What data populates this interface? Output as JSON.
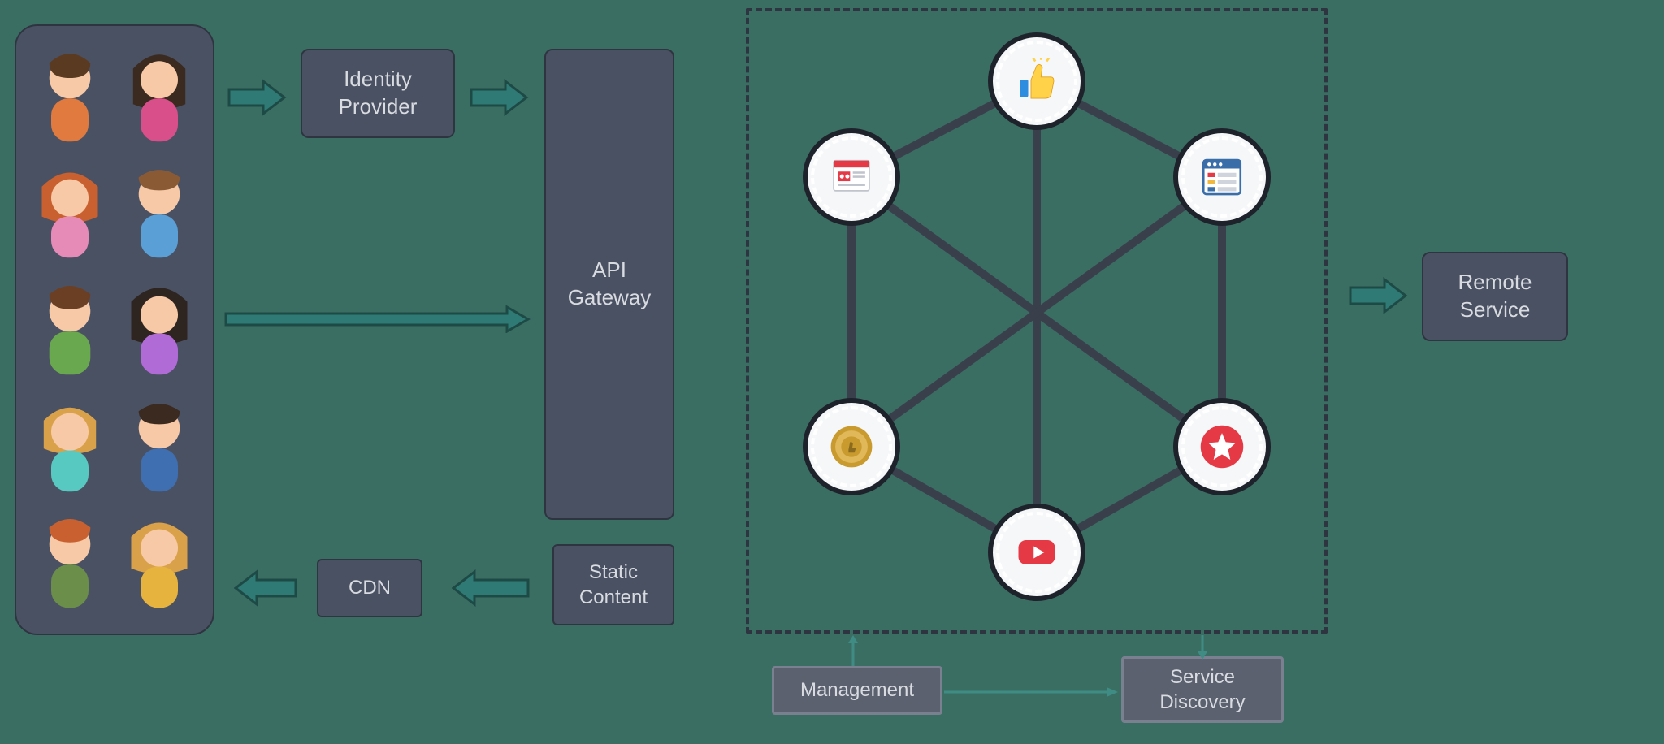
{
  "boxes": {
    "identity_provider": "Identity\nProvider",
    "api_gateway": "API\nGateway",
    "cdn": "CDN",
    "static_content": "Static\nContent",
    "remote_service": "Remote\nService",
    "management": "Management",
    "service_discovery": "Service\nDiscovery"
  },
  "nodes": {
    "top": "thumbs-up-icon",
    "upper_left": "news-card-icon",
    "upper_right": "browser-window-icon",
    "lower_left": "popular-badge-icon",
    "lower_right": "star-badge-icon",
    "bottom": "video-play-icon"
  },
  "arrows": {
    "users_to_identity": "right",
    "identity_to_gateway": "right",
    "users_to_gateway": "right",
    "static_to_cdn": "left",
    "cdn_to_users": "left",
    "mesh_to_remote": "right",
    "management_to_mesh": "up",
    "discovery_from_mesh": "down",
    "management_to_discovery": "right"
  },
  "users_count": 10
}
